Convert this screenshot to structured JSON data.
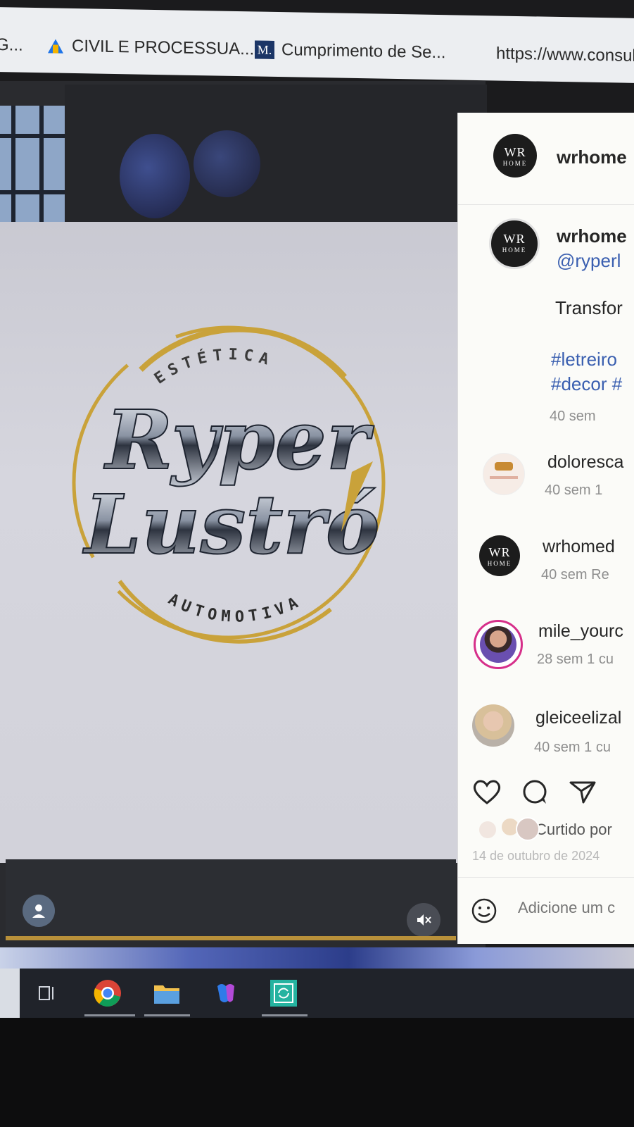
{
  "bookmarks": {
    "items": [
      {
        "label": "G..."
      },
      {
        "label": "CIVIL E PROCESSUA..."
      },
      {
        "label": "Cumprimento de Se...",
        "favicon": "M."
      },
      {
        "label": "https://www.consul"
      }
    ]
  },
  "logo": {
    "top_text": "ESTÉTICA",
    "brand_line1": "Ryper",
    "brand_line2": "Lustró",
    "bottom_text": "AUTOMOTIVA"
  },
  "instagram": {
    "header": {
      "username": "wrhome"
    },
    "brand_logo": {
      "line1": "WR",
      "line2": "HOME"
    },
    "post": {
      "username": "wrhome",
      "mention": "@ryperl",
      "caption": "Transfor",
      "hashtags_line1": "#letreiro",
      "hashtags_line2": "#decor #",
      "age": "40 sem"
    },
    "comments": [
      {
        "username": "doloresca",
        "meta": "40 sem   1"
      },
      {
        "username": "wrhomed",
        "meta": "40 sem    Re"
      },
      {
        "username": "mile_yourc",
        "meta": "28 sem   1 cu"
      },
      {
        "username": "gleiceelizal",
        "meta": "40 sem   1 cu"
      }
    ],
    "liked_by": "Curtido por",
    "date": "14 de outubro de 2024",
    "add_comment_placeholder": "Adicione um c"
  },
  "colors": {
    "gold": "#c9a23a",
    "ig_link": "#3a5fb0",
    "taskbar": "#20232a"
  },
  "icons": {
    "like": "heart-icon",
    "comment": "comment-icon",
    "share": "send-icon",
    "emoji": "emoji-icon",
    "mute": "mute-icon"
  }
}
